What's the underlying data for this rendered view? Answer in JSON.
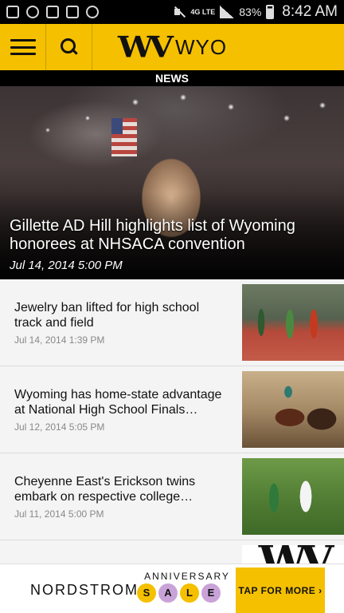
{
  "status_bar": {
    "battery": "83%",
    "network": "4G LTE",
    "time": "8:42 AM"
  },
  "header": {
    "logo_mark": "WV",
    "logo_text": "WYO"
  },
  "section": {
    "label": "NEWS"
  },
  "hero": {
    "title": "Gillette AD Hill highlights list of Wyoming honorees at NHSACA convention",
    "date": "Jul 14, 2014 5:00 PM"
  },
  "articles": [
    {
      "title": "Jewelry ban lifted for high school track and field",
      "date": "Jul 14, 2014 1:39 PM",
      "thumb": "track-photo"
    },
    {
      "title": "Wyoming has home-state advantage at National High School Finals…",
      "date": "Jul 12, 2014 5:05 PM",
      "thumb": "rodeo-photo"
    },
    {
      "title": "Cheyenne East's Erickson twins embark on respective college…",
      "date": "Jul 11, 2014 5:00 PM",
      "thumb": "soccer-photo"
    },
    {
      "title": "",
      "date": "",
      "thumb": "wv-logo"
    }
  ],
  "ad": {
    "brand": "NORDSTROM",
    "line1": "ANNIVERSARY",
    "sale_letters": [
      "S",
      "A",
      "L",
      "E"
    ],
    "sale_colors": [
      "#f5c000",
      "#c9a3d8",
      "#f5c000",
      "#c9a3d8"
    ],
    "cta": "TAP FOR MORE ›"
  },
  "colors": {
    "accent": "#f5c000",
    "header_text": "#111111"
  }
}
